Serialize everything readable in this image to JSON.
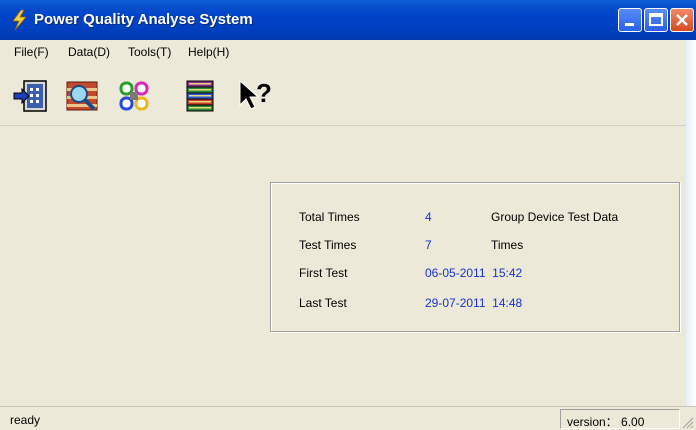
{
  "window": {
    "title": "Power Quality Analyse System",
    "app_icon": "lightning-icon",
    "controls": [
      "minimize-icon",
      "maximize-icon",
      "close-icon"
    ]
  },
  "menubar": {
    "items": [
      {
        "label": "File(F)"
      },
      {
        "label": "Data(D)"
      },
      {
        "label": "Tools(T)"
      },
      {
        "label": "Help(H)"
      }
    ]
  },
  "toolbar": {
    "buttons": [
      {
        "icon": "import-icon"
      },
      {
        "icon": "search-data-icon"
      },
      {
        "icon": "tools-icon"
      },
      {
        "icon": "database-books-icon"
      },
      {
        "icon": "help-pointer-icon"
      }
    ]
  },
  "info": {
    "total_times_label": "Total Times",
    "total_times_value": "4",
    "total_times_suffix": "Group Device Test Data",
    "test_times_label": "Test Times",
    "test_times_value": "7",
    "test_times_suffix": "Times",
    "first_test_label": "First Test",
    "first_test_value": "06-05-2011  15:42",
    "last_test_label": "Last Test",
    "last_test_value": "29-07-2011  14:48"
  },
  "status": {
    "message": "ready",
    "version": "version： 6.00"
  },
  "colors": {
    "titlebar": "#0040c0",
    "value_text": "#1a33c8",
    "window_bg": "#ece9d8"
  }
}
